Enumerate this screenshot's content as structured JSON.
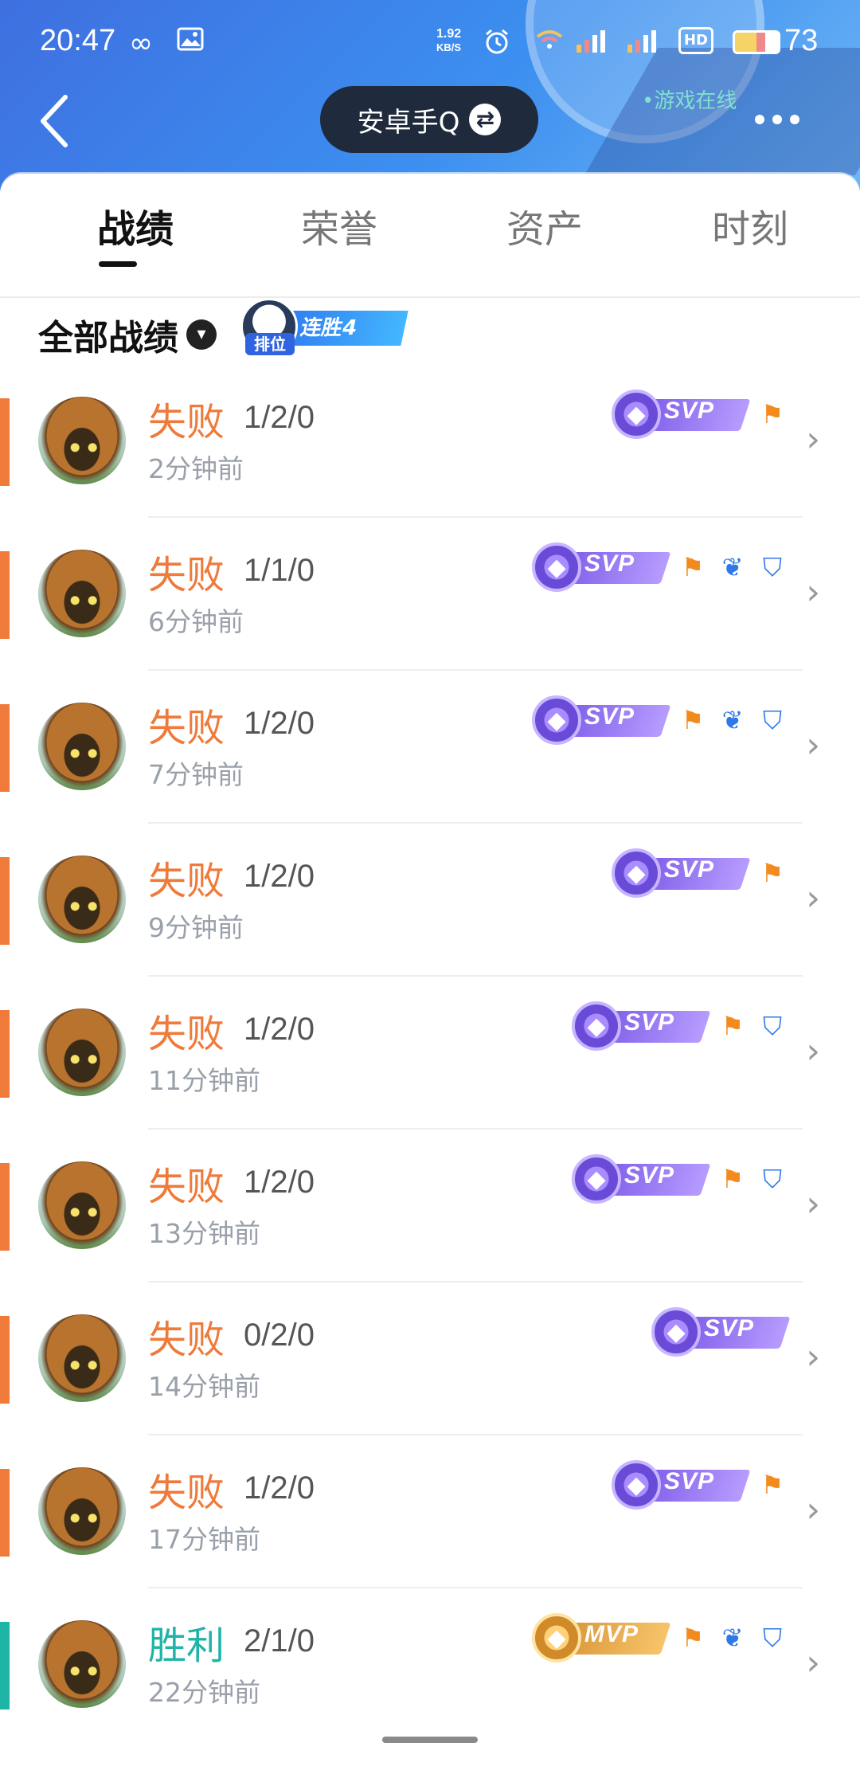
{
  "status_bar": {
    "time": "20:47",
    "net_speed_value": "1.92",
    "net_speed_unit": "KB/S",
    "battery": "73",
    "hd_label": "HD"
  },
  "header": {
    "account": "安卓手Q",
    "online_status": "游戏在线",
    "colors": {
      "gradient_start": "#3e6fe0",
      "gradient_end": "#6fb6f5"
    }
  },
  "tabs": [
    {
      "label": "战绩",
      "active": true
    },
    {
      "label": "荣誉",
      "active": false
    },
    {
      "label": "资产",
      "active": false
    },
    {
      "label": "时刻",
      "active": false
    }
  ],
  "filter": {
    "label": "全部战绩",
    "streak_tag": "排位",
    "streak_text": "连胜4"
  },
  "colors": {
    "loss": "#ef7a3a",
    "win": "#1fb5a6"
  },
  "matches": [
    {
      "result": "失败",
      "kda": "1/2/0",
      "time": "2分钟前",
      "badge": "SVP",
      "icons": [
        "flag-icon"
      ]
    },
    {
      "result": "失败",
      "kda": "1/1/0",
      "time": "6分钟前",
      "badge": "SVP",
      "icons": [
        "flag-icon",
        "feather-icon",
        "shield-icon"
      ]
    },
    {
      "result": "失败",
      "kda": "1/2/0",
      "time": "7分钟前",
      "badge": "SVP",
      "icons": [
        "flag-icon",
        "feather-icon",
        "shield-icon"
      ]
    },
    {
      "result": "失败",
      "kda": "1/2/0",
      "time": "9分钟前",
      "badge": "SVP",
      "icons": [
        "flag-icon"
      ]
    },
    {
      "result": "失败",
      "kda": "1/2/0",
      "time": "11分钟前",
      "badge": "SVP",
      "icons": [
        "flag-icon",
        "shield-icon"
      ]
    },
    {
      "result": "失败",
      "kda": "1/2/0",
      "time": "13分钟前",
      "badge": "SVP",
      "icons": [
        "flag-icon",
        "shield-icon"
      ]
    },
    {
      "result": "失败",
      "kda": "0/2/0",
      "time": "14分钟前",
      "badge": "SVP",
      "icons": []
    },
    {
      "result": "失败",
      "kda": "1/2/0",
      "time": "17分钟前",
      "badge": "SVP",
      "icons": [
        "flag-icon"
      ]
    },
    {
      "result": "胜利",
      "kda": "2/1/0",
      "time": "22分钟前",
      "badge": "MVP",
      "icons": [
        "flag-icon",
        "feather-icon",
        "shield-icon"
      ]
    }
  ]
}
